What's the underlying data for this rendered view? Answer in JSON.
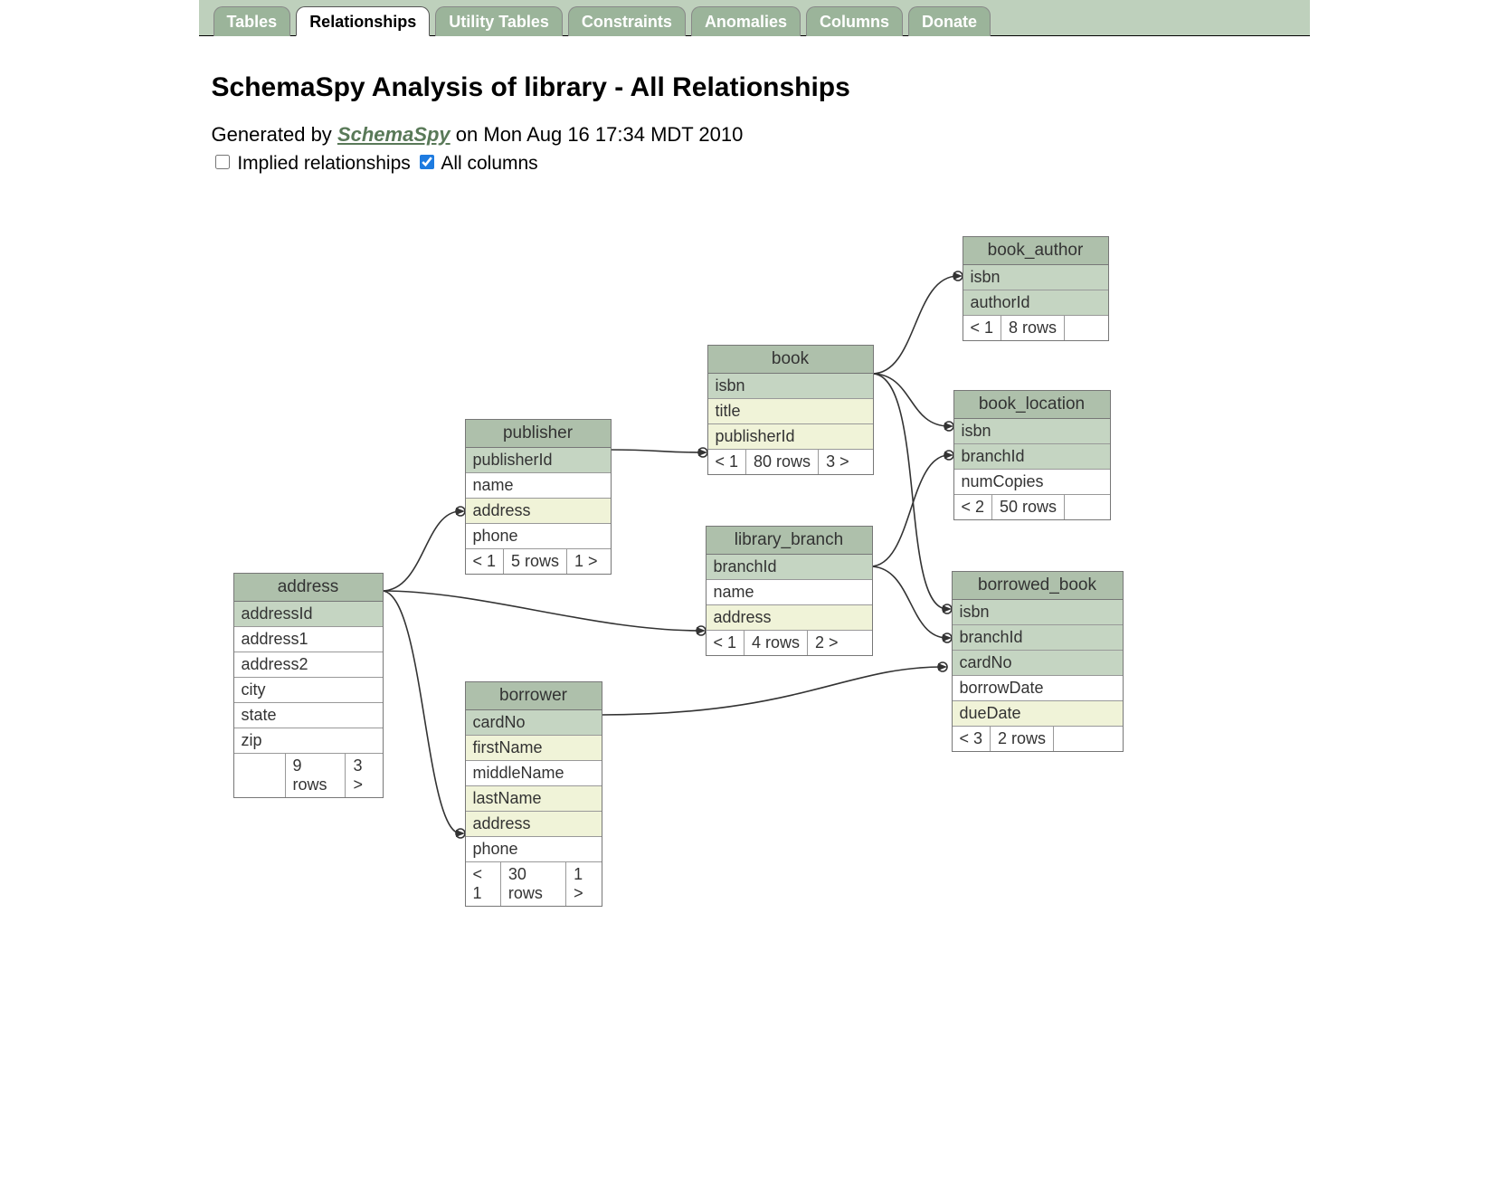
{
  "tabs": [
    {
      "label": "Tables"
    },
    {
      "label": "Relationships"
    },
    {
      "label": "Utility Tables"
    },
    {
      "label": "Constraints"
    },
    {
      "label": "Anomalies"
    },
    {
      "label": "Columns"
    },
    {
      "label": "Donate"
    }
  ],
  "active_tab_index": 1,
  "title": "SchemaSpy Analysis of library - All Relationships",
  "generated": {
    "prefix": "Generated by ",
    "link_text": "SchemaSpy",
    "suffix": " on Mon Aug 16 17:34 MDT 2010"
  },
  "options": {
    "implied": {
      "label": "Implied relationships",
      "checked": false
    },
    "all_columns": {
      "label": "All columns",
      "checked": true
    }
  },
  "tables": {
    "address": {
      "name": "address",
      "cols": [
        {
          "name": "addressId",
          "style": "green"
        },
        {
          "name": "address1",
          "style": "plain"
        },
        {
          "name": "address2",
          "style": "plain"
        },
        {
          "name": "city",
          "style": "plain"
        },
        {
          "name": "state",
          "style": "plain"
        },
        {
          "name": "zip",
          "style": "plain"
        }
      ],
      "foot": [
        "",
        "9 rows",
        "3 >"
      ]
    },
    "publisher": {
      "name": "publisher",
      "cols": [
        {
          "name": "publisherId",
          "style": "green"
        },
        {
          "name": "name",
          "style": "plain"
        },
        {
          "name": "address",
          "style": "cream"
        },
        {
          "name": "phone",
          "style": "plain"
        }
      ],
      "foot": [
        "< 1",
        "5 rows",
        "1 >"
      ]
    },
    "borrower": {
      "name": "borrower",
      "cols": [
        {
          "name": "cardNo",
          "style": "green"
        },
        {
          "name": "firstName",
          "style": "cream"
        },
        {
          "name": "middleName",
          "style": "plain"
        },
        {
          "name": "lastName",
          "style": "cream"
        },
        {
          "name": "address",
          "style": "cream"
        },
        {
          "name": "phone",
          "style": "plain"
        }
      ],
      "foot": [
        "< 1",
        "30 rows",
        "1 >"
      ]
    },
    "book": {
      "name": "book",
      "cols": [
        {
          "name": "isbn",
          "style": "green"
        },
        {
          "name": "title",
          "style": "cream"
        },
        {
          "name": "publisherId",
          "style": "cream"
        }
      ],
      "foot": [
        "< 1",
        "80 rows",
        "3 >"
      ]
    },
    "library_branch": {
      "name": "library_branch",
      "cols": [
        {
          "name": "branchId",
          "style": "green"
        },
        {
          "name": "name",
          "style": "plain"
        },
        {
          "name": "address",
          "style": "cream"
        }
      ],
      "foot": [
        "< 1",
        "4 rows",
        "2 >"
      ]
    },
    "book_author": {
      "name": "book_author",
      "cols": [
        {
          "name": "isbn",
          "style": "green"
        },
        {
          "name": "authorId",
          "style": "green"
        }
      ],
      "foot": [
        "< 1",
        "8 rows",
        ""
      ]
    },
    "book_location": {
      "name": "book_location",
      "cols": [
        {
          "name": "isbn",
          "style": "green"
        },
        {
          "name": "branchId",
          "style": "green"
        },
        {
          "name": "numCopies",
          "style": "plain"
        }
      ],
      "foot": [
        "< 2",
        "50 rows",
        ""
      ]
    },
    "borrowed_book": {
      "name": "borrowed_book",
      "cols": [
        {
          "name": "isbn",
          "style": "green"
        },
        {
          "name": "branchId",
          "style": "green"
        },
        {
          "name": "cardNo",
          "style": "green"
        },
        {
          "name": "borrowDate",
          "style": "plain"
        },
        {
          "name": "dueDate",
          "style": "cream"
        }
      ],
      "foot": [
        "< 3",
        "2 rows",
        ""
      ]
    }
  }
}
